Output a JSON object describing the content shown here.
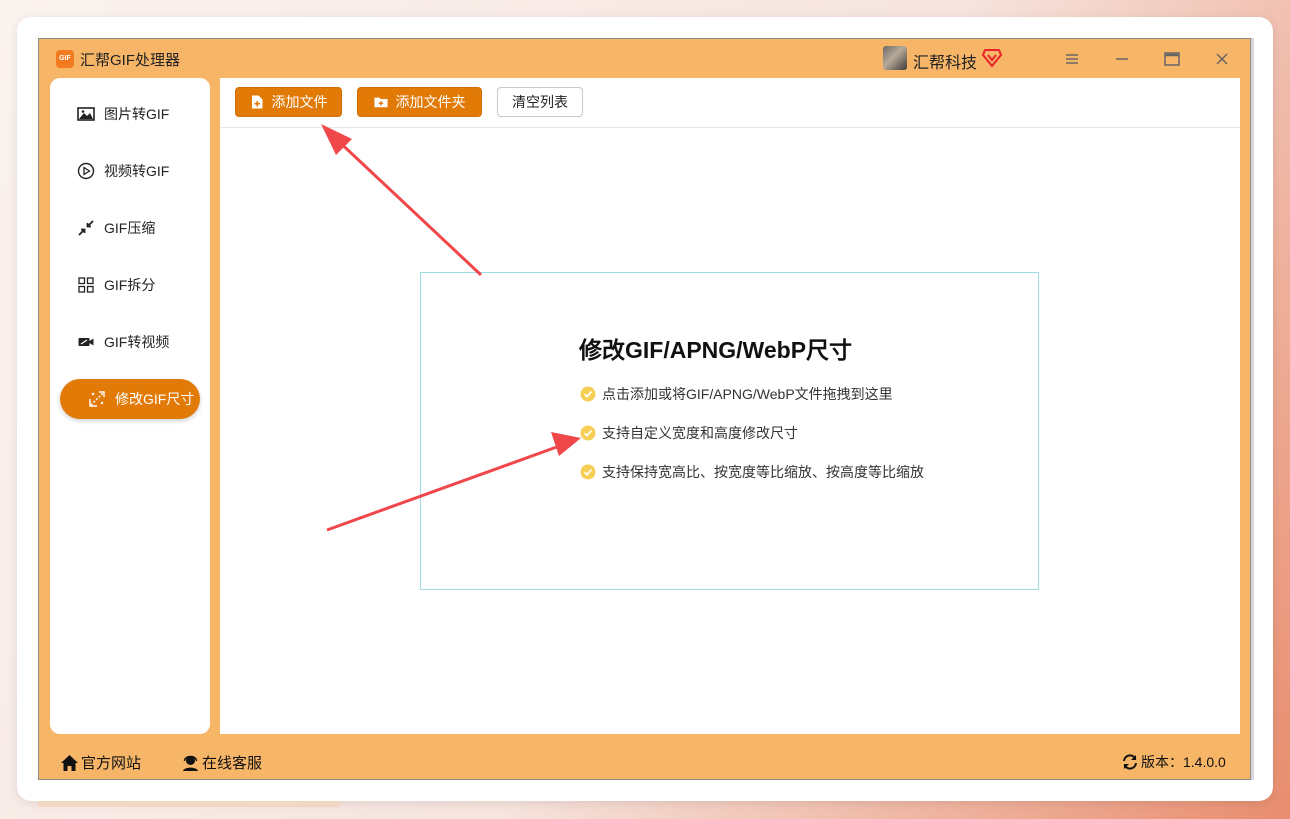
{
  "app": {
    "title": "汇帮GIF处理器",
    "logo_text": "GIF",
    "user_name": "汇帮科技",
    "accent_color": "#e17a07",
    "frame_color": "#f7b567"
  },
  "window_controls": [
    "menu-icon",
    "minimize-icon",
    "maximize-icon",
    "close-icon"
  ],
  "sidebar": {
    "items": [
      {
        "label": "图片转GIF",
        "icon": "image-icon",
        "active": false
      },
      {
        "label": "视频转GIF",
        "icon": "play-circle-icon",
        "active": false
      },
      {
        "label": "GIF压缩",
        "icon": "compress-icon",
        "active": false
      },
      {
        "label": "GIF拆分",
        "icon": "split-icon",
        "active": false
      },
      {
        "label": "GIF转视频",
        "icon": "video-camera-icon",
        "active": false
      },
      {
        "label": "修改GIF尺寸",
        "icon": "resize-icon",
        "active": true
      }
    ]
  },
  "toolbar": {
    "add_file_label": "添加文件",
    "add_folder_label": "添加文件夹",
    "clear_list_label": "清空列表"
  },
  "drop_zone": {
    "title": "修改GIF/APNG/WebP尺寸",
    "features": [
      "点击添加或将GIF/APNG/WebP文件拖拽到这里",
      "支持自定义宽度和高度修改尺寸",
      "支持保持宽高比、按宽度等比缩放、按高度等比缩放"
    ]
  },
  "statusbar": {
    "website_label": "官方网站",
    "support_label": "在线客服",
    "version_label": "版本：1.4.0.0"
  }
}
